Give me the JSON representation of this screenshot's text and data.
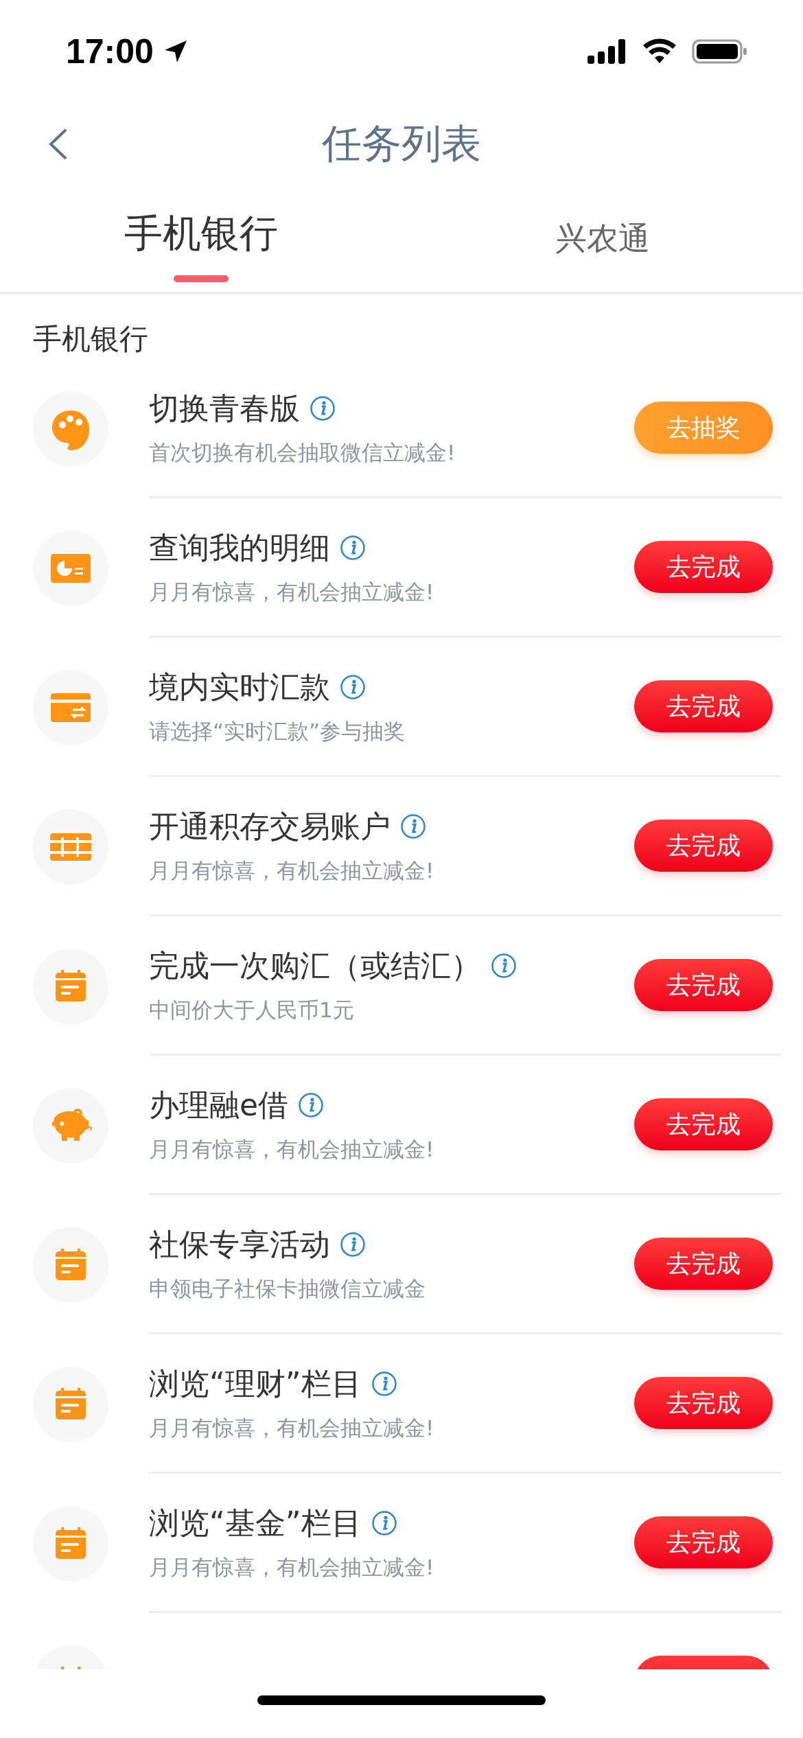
{
  "status_bar": {
    "time": "17:00"
  },
  "nav": {
    "title": "任务列表"
  },
  "tabs": [
    {
      "label": "手机银行",
      "selected": true
    },
    {
      "label": "兴农通",
      "selected": false
    }
  ],
  "section": {
    "title": "手机银行"
  },
  "tasks": [
    {
      "kind": "palette",
      "title": "切换青春版",
      "subtitle": "首次切换有机会抽取微信立减金!",
      "button": {
        "label": "去抽奖",
        "kind": "lottery"
      }
    },
    {
      "kind": "chart-card",
      "title": "查询我的明细",
      "subtitle": "月月有惊喜，有机会抽立减金!",
      "button": {
        "label": "去完成",
        "kind": "task"
      }
    },
    {
      "kind": "transfer-card",
      "title": "境内实时汇款",
      "subtitle": "请选择“实时汇款”参与抽奖",
      "button": {
        "label": "去完成",
        "kind": "task"
      }
    },
    {
      "kind": "ledger",
      "title": "开通积存交易账户",
      "subtitle": "月月有惊喜，有机会抽立减金!",
      "button": {
        "label": "去完成",
        "kind": "task"
      }
    },
    {
      "kind": "calendar",
      "title": "完成一次购汇（或结汇）",
      "subtitle": "中间价大于人民币1元",
      "button": {
        "label": "去完成",
        "kind": "task"
      }
    },
    {
      "kind": "piggy",
      "title": "办理融e借",
      "subtitle": "月月有惊喜，有机会抽立减金!",
      "button": {
        "label": "去完成",
        "kind": "task"
      }
    },
    {
      "kind": "calendar",
      "title": "社保专享活动",
      "subtitle": "申领电子社保卡抽微信立减金",
      "button": {
        "label": "去完成",
        "kind": "task"
      }
    },
    {
      "kind": "calendar",
      "title": "浏览“理财”栏目",
      "subtitle": "月月有惊喜，有机会抽立减金!",
      "button": {
        "label": "去完成",
        "kind": "task"
      }
    },
    {
      "kind": "calendar",
      "title": "浏览“基金”栏目",
      "subtitle": "月月有惊喜，有机会抽立减金!",
      "button": {
        "label": "去完成",
        "kind": "task"
      }
    },
    {
      "kind": "calendar",
      "button": {
        "kind": "task"
      }
    }
  ]
}
